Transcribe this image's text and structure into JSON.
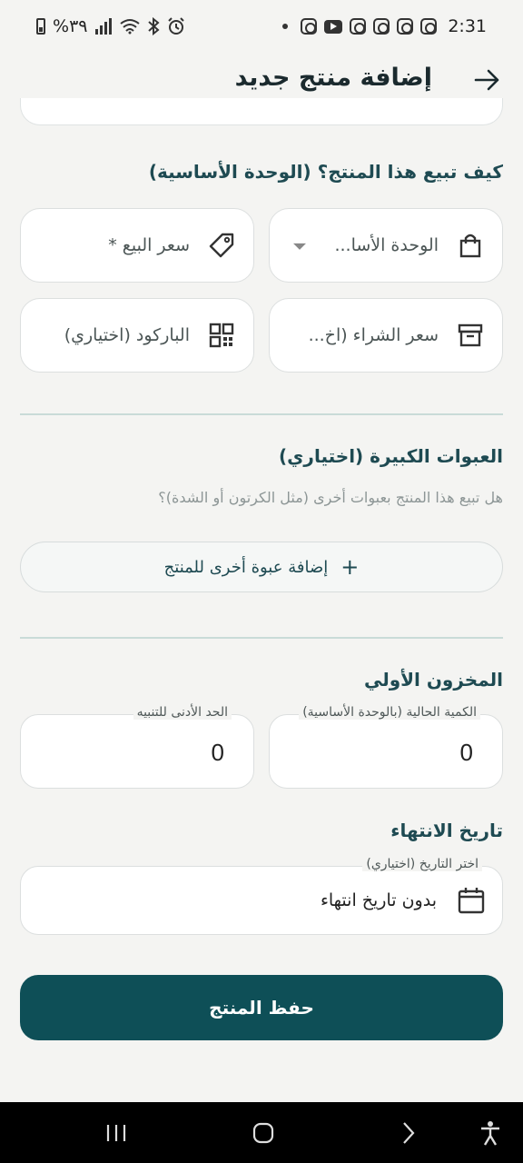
{
  "status_bar": {
    "time": "2:31",
    "battery": "%٣٩"
  },
  "header": {
    "title": "إضافة منتج جديد"
  },
  "unit_section": {
    "title": "كيف تبيع هذا المنتج؟ (الوحدة الأساسية)",
    "selling_price_placeholder": "سعر البيع *",
    "base_unit_placeholder": "الوحدة الأسا...",
    "barcode_placeholder": "الباركود (اختياري)",
    "purchase_price_placeholder": "سعر الشراء (اخ..."
  },
  "packages_section": {
    "title": "العبوات الكبيرة (اختياري)",
    "hint": "هل تبيع هذا المنتج بعبوات أخرى (مثل الكرتون أو الشدة)؟",
    "add_button_label": "إضافة عبوة أخرى للمنتج",
    "add_button_icon": "+"
  },
  "stock_section": {
    "title": "المخزون الأولي",
    "current_qty_label": "الكمية الحالية (بالوحدة الأساسية)",
    "current_qty_value": "0",
    "min_alert_label": "الحد الأدنى للتنبيه",
    "min_alert_value": "0"
  },
  "expiry_section": {
    "title": "تاريخ الانتهاء",
    "date_label": "اختر التاريخ (اختياري)",
    "date_value": "بدون تاريخ انتهاء"
  },
  "save_button_label": "حفظ المنتج",
  "colors": {
    "primary": "#0e4f57",
    "background": "#f4f4f2",
    "section_title": "#1e4a52"
  },
  "icons": [
    "back-arrow-icon",
    "tag-icon",
    "shopping-bag-icon",
    "qr-code-icon",
    "archive-box-icon",
    "plus-icon",
    "calendar-icon"
  ]
}
